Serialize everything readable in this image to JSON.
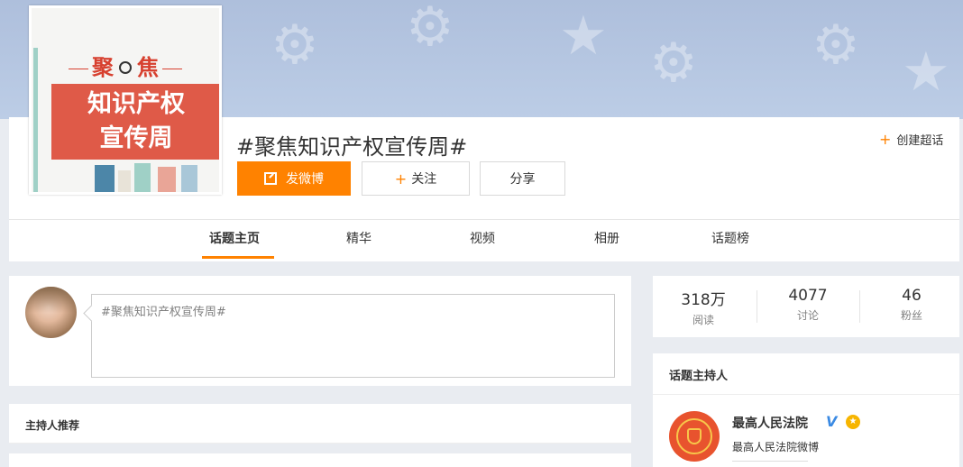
{
  "topic": {
    "cover": {
      "top_word_left": "聚",
      "top_word_right": "焦",
      "box_line1": "知识产权",
      "box_line2": "宣传周"
    },
    "title": "#聚焦知识产权宣传周#",
    "create_label": "创建超话"
  },
  "actions": {
    "post_label": "发微博",
    "follow_label": "关注",
    "share_label": "分享"
  },
  "tabs": [
    {
      "label": "话题主页",
      "active": true
    },
    {
      "label": "精华",
      "active": false
    },
    {
      "label": "视频",
      "active": false
    },
    {
      "label": "相册",
      "active": false
    },
    {
      "label": "话题榜",
      "active": false
    }
  ],
  "composer": {
    "text": "#聚焦知识产权宣传周#"
  },
  "recommend": {
    "title": "主持人推荐"
  },
  "stats": [
    {
      "value": "318万",
      "label": "阅读"
    },
    {
      "value": "4077",
      "label": "讨论"
    },
    {
      "value": "46",
      "label": "粉丝"
    }
  ],
  "host": {
    "section_title": "话题主持人",
    "name": "最高人民法院",
    "desc": "最高人民法院微博",
    "verified_mark": "V"
  },
  "colors": {
    "accent": "#ff8200",
    "cover_red": "#df5a48",
    "banner": "#b4c5e1"
  },
  "icons": [
    "edit-icon",
    "plus-icon",
    "verified-icon",
    "badge-icon"
  ]
}
